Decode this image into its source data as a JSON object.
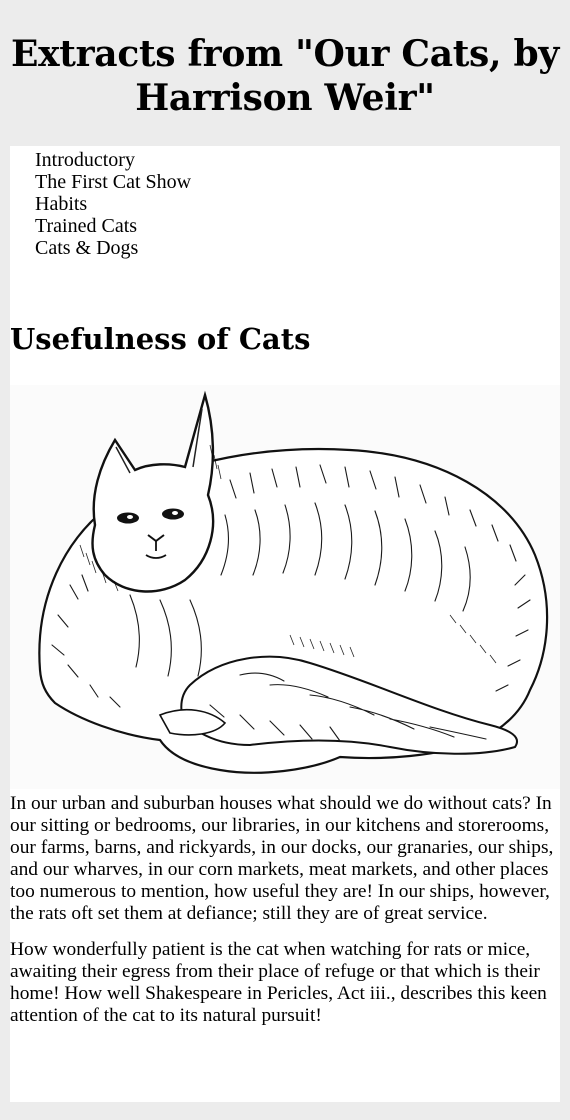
{
  "header": {
    "title": "Extracts from \"Our Cats, by Harrison Weir\""
  },
  "toc": {
    "items": [
      {
        "label": "Introductory"
      },
      {
        "label": "The First Cat Show"
      },
      {
        "label": "Habits"
      },
      {
        "label": "Trained Cats"
      },
      {
        "label": "Cats & Dogs"
      }
    ]
  },
  "section": {
    "title": "Usefulness of Cats",
    "paragraphs": [
      "In our urban and suburban houses what should we do without cats? In our sitting or bedrooms, our libraries, in our kitchens and storerooms, our farms, barns, and rickyards, in our docks, our granaries, our ships, and our wharves, in our corn markets, meat markets, and other places too numerous to mention, how useful they are! In our ships, however, the rats oft set them at defiance; still they are of great service.",
      "How wonderfully patient is the cat when watching for rats or mice, awaiting their egress from their place of refuge or that which is their home! How well Shakespeare in Pericles, Act iii., describes this keen attention of the cat to its natural pursuit!"
    ]
  }
}
